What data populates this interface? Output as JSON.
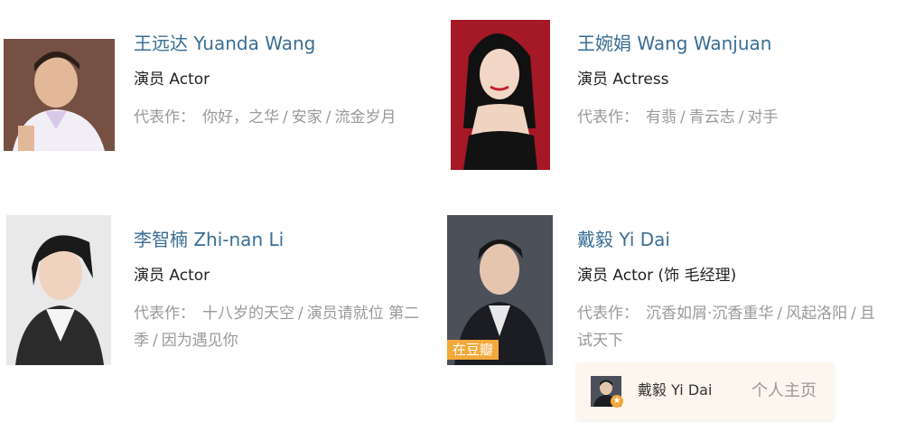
{
  "people": [
    {
      "name": "王远达 Yuanda Wang",
      "role": "演员 Actor",
      "works_label": "代表作：",
      "works": [
        "你好，之华",
        "安家",
        "流金岁月"
      ]
    },
    {
      "name": "王婉娟 Wang Wanjuan",
      "role": "演员 Actress",
      "works_label": "代表作：",
      "works": [
        "有翡",
        "青云志",
        "对手"
      ]
    },
    {
      "name": "李智楠 Zhi-nan Li",
      "role": "演员 Actor",
      "works_label": "代表作：",
      "works": [
        "十八岁的天空",
        "演员请就位 第二季",
        "因为遇见你"
      ]
    },
    {
      "name": "戴毅 Yi Dai",
      "role": "演员 Actor (饰 毛经理)",
      "works_label": "代表作：",
      "works": [
        "沉香如屑·沉香重华",
        "风起洛阳",
        "且试天下"
      ],
      "badge": "在豆瓣"
    }
  ],
  "popup": {
    "name": "戴毅 Yi Dai",
    "link": "个人主页",
    "badge_icon": "star-icon"
  },
  "colors": {
    "name_link": "#3a6e94",
    "muted": "#999999",
    "badge": "#f2a93b",
    "popup_bg": "#fdf6ee"
  }
}
